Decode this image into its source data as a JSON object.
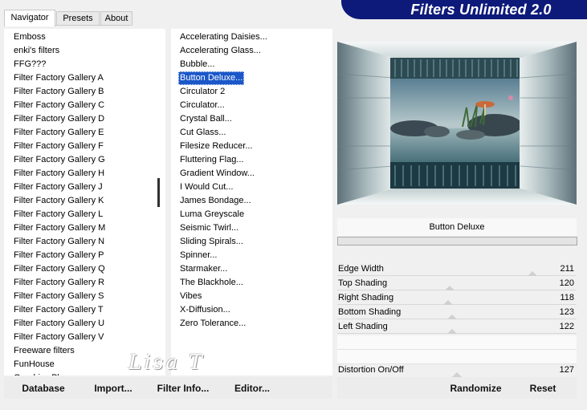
{
  "tabs": [
    {
      "label": "Navigator"
    },
    {
      "label": "Presets"
    },
    {
      "label": "About"
    }
  ],
  "header": {
    "title": "Filters Unlimited 2.0"
  },
  "categories": [
    "Emboss",
    "enki's filters",
    "FFG???",
    "Filter Factory Gallery A",
    "Filter Factory Gallery B",
    "Filter Factory Gallery C",
    "Filter Factory Gallery D",
    "Filter Factory Gallery E",
    "Filter Factory Gallery F",
    "Filter Factory Gallery G",
    "Filter Factory Gallery H",
    "Filter Factory Gallery J",
    "Filter Factory Gallery K",
    "Filter Factory Gallery L",
    "Filter Factory Gallery M",
    "Filter Factory Gallery N",
    "Filter Factory Gallery P",
    "Filter Factory Gallery Q",
    "Filter Factory Gallery R",
    "Filter Factory Gallery S",
    "Filter Factory Gallery T",
    "Filter Factory Gallery U",
    "Filter Factory Gallery V",
    "Freeware filters",
    "FunHouse",
    "Graphics Plus"
  ],
  "filters": [
    "Accelerating Daisies...",
    "Accelerating Glass...",
    "Bubble...",
    "Button Deluxe...",
    "Circulator 2",
    "Circulator...",
    "Crystal Ball...",
    "Cut Glass...",
    "Filesize Reducer...",
    "Fluttering Flag...",
    "Gradient Window...",
    "I Would Cut...",
    "James Bondage...",
    "Luma Greyscale",
    "Seismic Twirl...",
    "Sliding Spirals...",
    "Spinner...",
    "Starmaker...",
    "The Blackhole...",
    "Vibes",
    "X-Diffusion...",
    "Zero Tolerance..."
  ],
  "selected_filter": "Button Deluxe...",
  "filter_name": "Button Deluxe",
  "sliders": [
    {
      "label": "Edge Width",
      "value": "211",
      "fraction": 0.83
    },
    {
      "label": "Top Shading",
      "value": "120",
      "fraction": 0.47
    },
    {
      "label": "Right Shading",
      "value": "118",
      "fraction": 0.46
    },
    {
      "label": "Bottom Shading",
      "value": "123",
      "fraction": 0.48
    },
    {
      "label": "Left Shading",
      "value": "122",
      "fraction": 0.48
    }
  ],
  "toggle": {
    "label": "Distortion On/Off",
    "value": "127",
    "fraction": 0.5
  },
  "buttons": {
    "database": "Database",
    "import": "Import...",
    "filter_info": "Filter Info...",
    "editor": "Editor...",
    "randomize": "Randomize",
    "reset": "Reset"
  },
  "watermark": "Lisa T",
  "colors": {
    "header_bg": "#0d1a7a",
    "selection": "#1a57c8",
    "window_bg": "#f0f0f0"
  }
}
